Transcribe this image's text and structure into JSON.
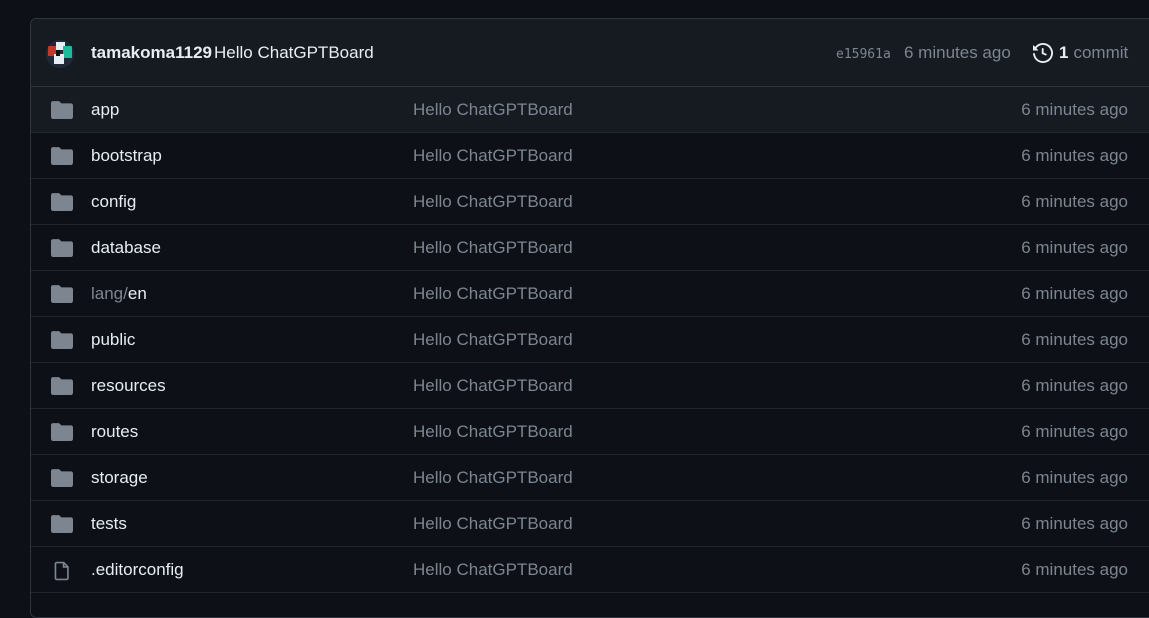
{
  "commit": {
    "author": "tamakoma1129",
    "message": "Hello ChatGPTBoard",
    "sha": "e15961a",
    "time": "6 minutes ago",
    "history_count": "1",
    "history_label": "commit"
  },
  "files": [
    {
      "type": "folder",
      "prefix": "",
      "name": "app",
      "message": "Hello ChatGPTBoard",
      "time": "6 minutes ago"
    },
    {
      "type": "folder",
      "prefix": "",
      "name": "bootstrap",
      "message": "Hello ChatGPTBoard",
      "time": "6 minutes ago"
    },
    {
      "type": "folder",
      "prefix": "",
      "name": "config",
      "message": "Hello ChatGPTBoard",
      "time": "6 minutes ago"
    },
    {
      "type": "folder",
      "prefix": "",
      "name": "database",
      "message": "Hello ChatGPTBoard",
      "time": "6 minutes ago"
    },
    {
      "type": "folder",
      "prefix": "lang/",
      "name": "en",
      "message": "Hello ChatGPTBoard",
      "time": "6 minutes ago"
    },
    {
      "type": "folder",
      "prefix": "",
      "name": "public",
      "message": "Hello ChatGPTBoard",
      "time": "6 minutes ago"
    },
    {
      "type": "folder",
      "prefix": "",
      "name": "resources",
      "message": "Hello ChatGPTBoard",
      "time": "6 minutes ago"
    },
    {
      "type": "folder",
      "prefix": "",
      "name": "routes",
      "message": "Hello ChatGPTBoard",
      "time": "6 minutes ago"
    },
    {
      "type": "folder",
      "prefix": "",
      "name": "storage",
      "message": "Hello ChatGPTBoard",
      "time": "6 minutes ago"
    },
    {
      "type": "folder",
      "prefix": "",
      "name": "tests",
      "message": "Hello ChatGPTBoard",
      "time": "6 minutes ago"
    },
    {
      "type": "file",
      "prefix": "",
      "name": ".editorconfig",
      "message": "Hello ChatGPTBoard",
      "time": "6 minutes ago"
    }
  ],
  "colors": {
    "background": "#0d1117",
    "header_bg": "#161b22",
    "border": "#30363d",
    "text_primary": "#e6edf3",
    "text_muted": "#7d8590",
    "folder_icon": "#7d8590"
  }
}
